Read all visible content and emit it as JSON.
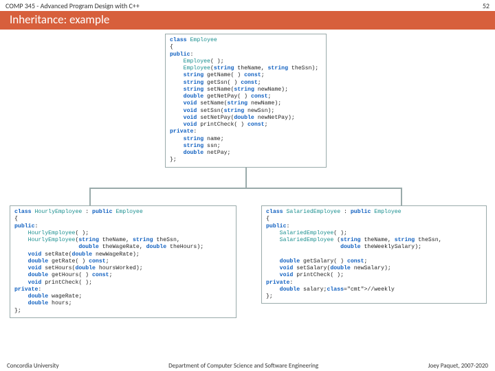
{
  "header": {
    "course": "COMP 345 - Advanced Program Design with C++",
    "page": "52"
  },
  "title": "Inheritance: example",
  "code": {
    "employee": "class Employee\n{\npublic:\n    Employee( );\n    Employee(string theName, string theSsn);\n    string getName( ) const;\n    string getSsn( ) const;\n    string setName(string newName);\n    double getNetPay( ) const;\n    void setName(string newName);\n    void setSsn(string newSsn);\n    void setNetPay(double newNetPay);\n    void printCheck( ) const;\nprivate:\n    string name;\n    string ssn;\n    double netPay;\n};",
    "hourly": "class HourlyEmployee : public Employee\n{\npublic:\n    HourlyEmployee( );\n    HourlyEmployee(string theName, string theSsn,\n                   double theWageRate, double theHours);\n    void setRate(double newWageRate);\n    double getRate( ) const;\n    void setHours(double hoursWorked);\n    double getHours( ) const;\n    void printCheck( );\nprivate:\n    double wageRate;\n    double hours;\n};",
    "salaried": "class SalariedEmployee : public Employee\n{\npublic:\n    SalariedEmployee( );\n    SalariedEmployee (string theName, string theSsn,\n                      double theWeeklySalary);\n\n    double getSalary( ) const;\n    void setSalary(double newSalary);\n    void printCheck( );\nprivate:\n    double salary;//weekly\n};"
  },
  "footer": {
    "left": "Concordia University",
    "center": "Department of Computer Science and Software Engineering",
    "right": "Joey Paquet, 2007-2020"
  }
}
